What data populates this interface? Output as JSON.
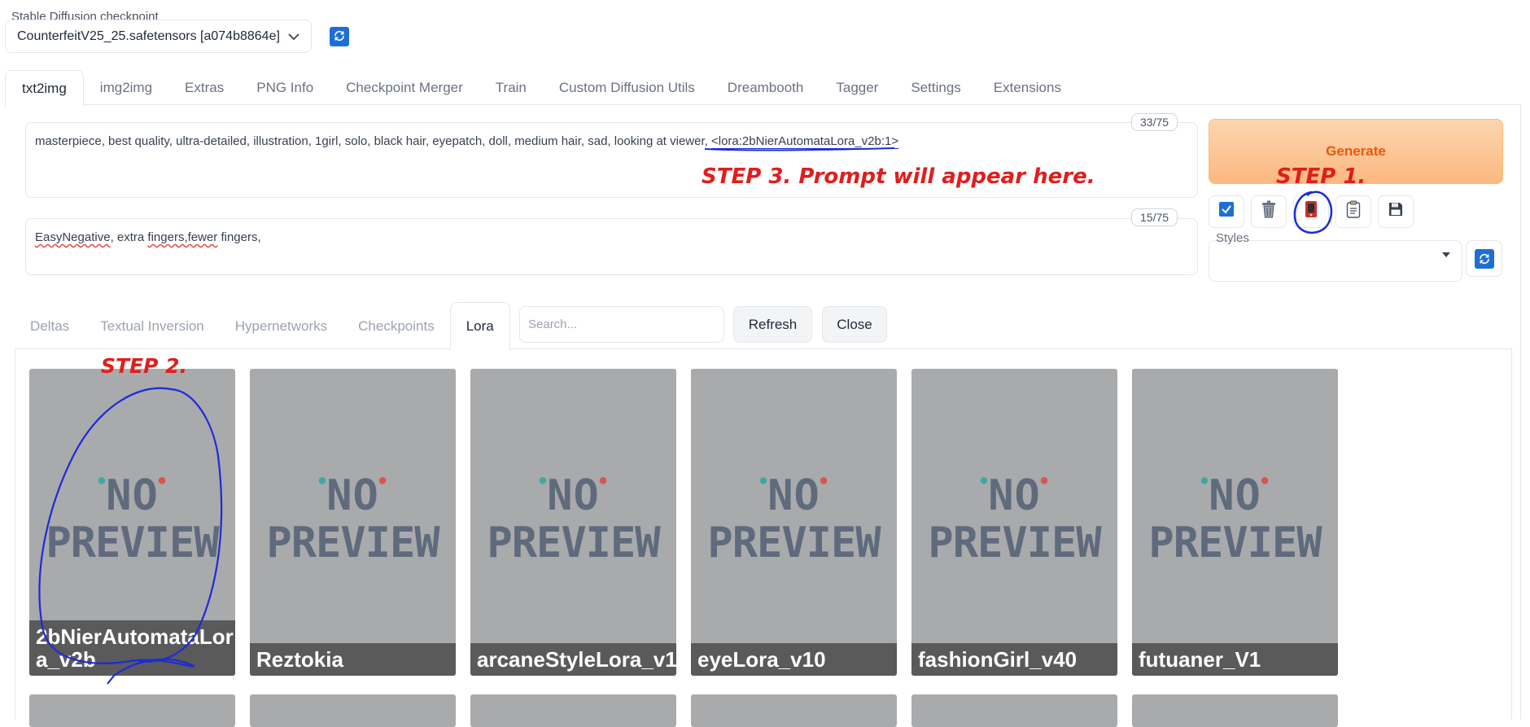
{
  "checkpoint": {
    "label": "Stable Diffusion checkpoint",
    "value": "CounterfeitV25_25.safetensors [a074b8864e]",
    "refresh_icon": "refresh-icon"
  },
  "main_tabs": [
    {
      "label": "txt2img",
      "active": true
    },
    {
      "label": "img2img"
    },
    {
      "label": "Extras"
    },
    {
      "label": "PNG Info"
    },
    {
      "label": "Checkpoint Merger"
    },
    {
      "label": "Train"
    },
    {
      "label": "Custom Diffusion Utils"
    },
    {
      "label": "Dreambooth"
    },
    {
      "label": "Tagger"
    },
    {
      "label": "Settings"
    },
    {
      "label": "Extensions"
    }
  ],
  "prompt": {
    "text": "masterpiece, best quality, ultra-detailed, illustration, 1girl, solo, black hair, eyepatch, doll, medium hair, sad, looking at viewer, ",
    "lora_token": "<lora:2bNierAutomataLora_v2b:1>",
    "token_count": "33/75"
  },
  "negative_prompt": {
    "part1": "EasyNegative",
    "part2": ", extra ",
    "part3": "fingers,fewer",
    "part4": " fingers,",
    "token_count": "15/75"
  },
  "generate": {
    "label": "Generate"
  },
  "tools": [
    {
      "icon": "checkbox-icon"
    },
    {
      "icon": "trash-icon"
    },
    {
      "icon": "show-extra-networks-icon"
    },
    {
      "icon": "clipboard-icon"
    },
    {
      "icon": "save-icon"
    }
  ],
  "styles": {
    "label": "Styles",
    "value": ""
  },
  "extra_networks": {
    "tabs": [
      {
        "label": "Deltas"
      },
      {
        "label": "Textual Inversion"
      },
      {
        "label": "Hypernetworks"
      },
      {
        "label": "Checkpoints"
      },
      {
        "label": "Lora",
        "active": true
      }
    ],
    "search_placeholder": "Search...",
    "refresh_label": "Refresh",
    "close_label": "Close",
    "no_preview_line1": "NO",
    "no_preview_line2": "PREVIEW",
    "cards": [
      {
        "name": "2bNierAutomataLor a_v2b",
        "line1": "2bNierAutomataLor",
        "line2": "a_v2b"
      },
      {
        "name": "Reztokia"
      },
      {
        "name": "arcaneStyleLora_v1"
      },
      {
        "name": "eyeLora_v10"
      },
      {
        "name": "fashionGirl_v40"
      },
      {
        "name": "futuaner_V1"
      }
    ]
  },
  "annotations": {
    "step1": "STEP 1.",
    "step2": "STEP 2.",
    "step3": "STEP 3. Prompt will appear here.",
    "color": "#e11d1d",
    "pen_color": "#1d2bd6"
  }
}
